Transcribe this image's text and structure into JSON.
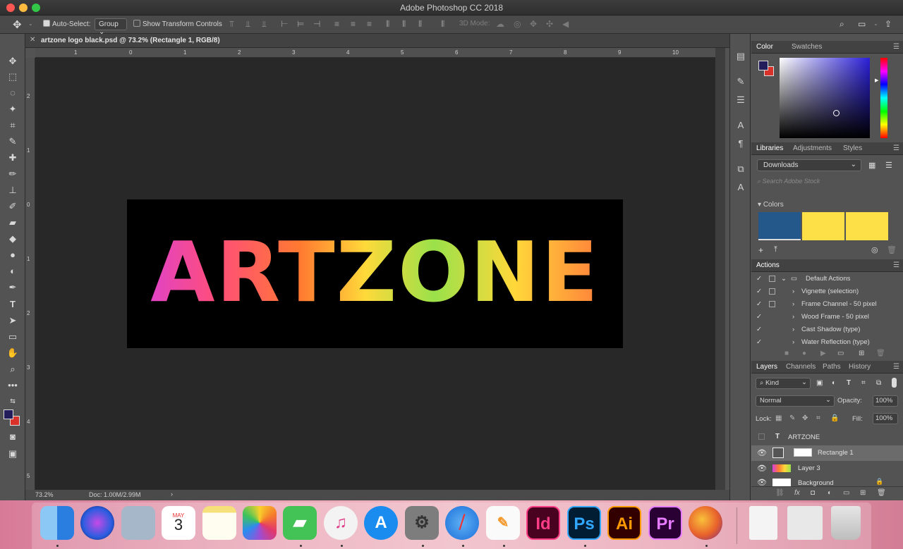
{
  "window": {
    "title": "Adobe Photoshop CC 2018"
  },
  "options": {
    "auto_select_label": "Auto-Select:",
    "auto_select_value": "Group",
    "show_transform_label": "Show Transform Controls",
    "mode_3d_label": "3D Mode:"
  },
  "document": {
    "tab_title": "artzone logo black.psd @ 73.2% (Rectangle 1, RGB/8)",
    "artwork_text": "ARTZONE",
    "ruler_top": [
      "1",
      "0",
      "1",
      "2",
      "3",
      "4",
      "5",
      "6",
      "7",
      "8",
      "9",
      "10"
    ],
    "ruler_left": [
      "2",
      "1",
      "0",
      "1",
      "2",
      "3",
      "4",
      "5"
    ]
  },
  "status": {
    "zoom": "73.2%",
    "doc_size": "Doc: 1.00M/2.99M"
  },
  "color_panel": {
    "tabs": [
      "Color",
      "Swatches"
    ],
    "foreground": "#241d5c",
    "background": "#d8322a"
  },
  "libraries_panel": {
    "tabs": [
      "Libraries",
      "Adjustments",
      "Styles"
    ],
    "library": "Downloads",
    "search_placeholder": "Search Adobe Stock",
    "section": "Colors",
    "swatches": [
      "#24588a",
      "#fde047",
      "#fde047"
    ]
  },
  "actions_panel": {
    "title": "Actions",
    "set": "Default Actions",
    "items": [
      "Vignette (selection)",
      "Frame Channel - 50 pixel",
      "Wood Frame - 50 pixel",
      "Cast Shadow (type)",
      "Water Reflection (type)"
    ]
  },
  "layers_panel": {
    "tabs": [
      "Layers",
      "Channels",
      "Paths",
      "History"
    ],
    "filter": "Kind",
    "blend_mode": "Normal",
    "opacity_label": "Opacity:",
    "opacity": "100%",
    "lock_label": "Lock:",
    "fill_label": "Fill:",
    "fill": "100%",
    "layers": [
      {
        "name": "ARTZONE",
        "type": "text"
      },
      {
        "name": "Rectangle 1",
        "type": "shape"
      },
      {
        "name": "Layer 3",
        "type": "pixel"
      },
      {
        "name": "Background",
        "type": "background"
      }
    ]
  },
  "dock": {
    "apps": [
      {
        "name": "Finder",
        "label": "",
        "color": "#3a8ee6"
      },
      {
        "name": "Siri",
        "label": "",
        "color": "#2b2b6e"
      },
      {
        "name": "Preview",
        "label": "",
        "color": "#8aa1b9"
      },
      {
        "name": "Calendar",
        "label": "3",
        "month": "MAY",
        "color": "#ffffff"
      },
      {
        "name": "Notes",
        "label": "",
        "color": "#fce98a"
      },
      {
        "name": "Photos",
        "label": "",
        "color": "#ffffff"
      },
      {
        "name": "FaceTime",
        "label": "",
        "color": "#3fbf4d"
      },
      {
        "name": "iTunes",
        "label": "♫",
        "color": "#f2f2f2"
      },
      {
        "name": "App Store",
        "label": "A",
        "color": "#1a8cf0"
      },
      {
        "name": "System Preferences",
        "label": "⚙",
        "color": "#8a8a8a"
      },
      {
        "name": "Safari",
        "label": "",
        "color": "#f2f6fb"
      },
      {
        "name": "Pages",
        "label": "",
        "color": "#f6a334"
      },
      {
        "name": "InDesign",
        "label": "Id",
        "color": "#49021f"
      },
      {
        "name": "Photoshop",
        "label": "Ps",
        "color": "#001d34"
      },
      {
        "name": "Illustrator",
        "label": "Ai",
        "color": "#330000"
      },
      {
        "name": "Premiere",
        "label": "Pr",
        "color": "#2a0034"
      },
      {
        "name": "Firefox",
        "label": "",
        "color": "#e8612c"
      }
    ]
  }
}
